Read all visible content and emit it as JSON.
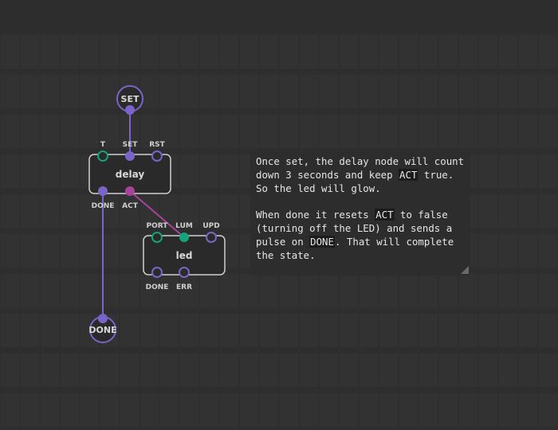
{
  "nodes": {
    "set_terminal": {
      "label": "SET"
    },
    "delay": {
      "label": "delay",
      "inputs": [
        "T",
        "SET",
        "RST"
      ],
      "outputs": [
        "DONE",
        "ACT"
      ]
    },
    "led": {
      "label": "led",
      "inputs": [
        "PORT",
        "LUM",
        "UPD"
      ],
      "outputs": [
        "DONE",
        "ERR"
      ]
    },
    "done_terminal": {
      "label": "DONE"
    }
  },
  "comment": {
    "p1_a": "Once set, the delay node will count down 3 seconds and keep ",
    "p1_code": "ACT",
    "p1_b": " true. So the led will glow.",
    "p2_a": "When done it resets ",
    "p2_code1": "ACT",
    "p2_b": " to false (turning off the LED) and sends a pulse on ",
    "p2_code2": "DONE",
    "p2_c": ". That will complete the state."
  },
  "colors": {
    "background": "#2d2d2d",
    "grid_cell": "#333333",
    "grid_line": "#262626",
    "node_border": "#d0d0d0",
    "node_fill": "#2a2a2a",
    "pin_pulse": "#7b64c8",
    "pin_number": "#14a37a",
    "pin_bool": "#a8439a",
    "link_pulse": "#7b64c8",
    "link_bool": "#a8439a"
  }
}
